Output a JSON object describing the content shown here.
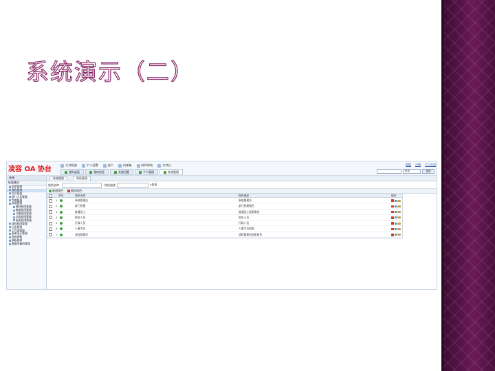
{
  "slide": {
    "title": "系统演示（二）"
  },
  "app": {
    "logo": "凌容 OA 协台",
    "toolbar": [
      "公共频道",
      "个人设置",
      "退户",
      "内邮箱",
      "邮件帮助",
      "文件扫"
    ],
    "top_tabs": [
      {
        "label": "我的桌面",
        "active": false
      },
      {
        "label": "我的信息",
        "active": false
      },
      {
        "label": "系统设置",
        "active": false
      },
      {
        "label": "个人管理",
        "active": false
      },
      {
        "label": "系统管理",
        "active": true
      }
    ],
    "top_links": [
      "帮助",
      "注销",
      "个人主页"
    ],
    "top_dropdown": "所有",
    "top_button": "搜索",
    "sidebar": {
      "header": "系统",
      "header2": "标准模式",
      "items": [
        {
          "label": "组织管理",
          "level": 1,
          "selected": false
        },
        {
          "label": "角色管理",
          "level": 1,
          "selected": true
        },
        {
          "label": "用户管理",
          "level": 1,
          "selected": false
        },
        {
          "label": "部门人员管理",
          "level": 1,
          "selected": false
        },
        {
          "label": "字典管理",
          "level": 1,
          "selected": false
        },
        {
          "label": "权限管理",
          "level": 1,
          "selected": false
        },
        {
          "label": "模块权限管理",
          "level": 2,
          "selected": false
        },
        {
          "label": "数据权限管理",
          "level": 2,
          "selected": false
        },
        {
          "label": "功能权限管理",
          "level": 2,
          "selected": false
        },
        {
          "label": "字段权限管理",
          "level": 2,
          "selected": false
        },
        {
          "label": "报表权限管理",
          "level": 2,
          "selected": false
        },
        {
          "label": "流程权限管理",
          "level": 1,
          "selected": false
        },
        {
          "label": "日志管理",
          "level": 1,
          "selected": false
        },
        {
          "label": "工作流管理",
          "level": 1,
          "selected": false
        },
        {
          "label": "表单设计管理",
          "level": 1,
          "selected": false
        },
        {
          "label": "系统参数",
          "level": 1,
          "selected": false
        },
        {
          "label": "模板管理",
          "level": 1,
          "selected": false
        },
        {
          "label": "数据库备份管理",
          "level": 1,
          "selected": false
        }
      ]
    },
    "main": {
      "tabs": [
        "系统管理",
        "角色管理"
      ],
      "search": {
        "label1": "角色名称",
        "label2": "角色描述",
        "go": "查询"
      },
      "actions": {
        "add": "新增角色",
        "delete": "删除角色"
      },
      "columns": [
        "",
        "序号",
        "角色名称",
        "角色描述",
        "操作"
      ],
      "rows": [
        {
          "no": "1",
          "name": "系统管理员",
          "desc": "系统管理员"
        },
        {
          "no": "2",
          "name": "部门经理",
          "desc": "部门经理角色"
        },
        {
          "no": "3",
          "name": "普通员工",
          "desc": "普通员工权限角色"
        },
        {
          "no": "4",
          "name": "财务人员",
          "desc": "财务人员"
        },
        {
          "no": "5",
          "name": "行政人员",
          "desc": "行政人员"
        },
        {
          "no": "6",
          "name": "人事专员",
          "desc": "人事专员权限"
        },
        {
          "no": "7",
          "name": "流程管理员",
          "desc": "流程管理员权限角色"
        }
      ]
    }
  },
  "colors": {
    "band": "#4e1240",
    "logo": "#e21a1a",
    "title_stroke": "#8a2a6a"
  }
}
